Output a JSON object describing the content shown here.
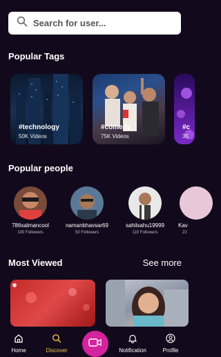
{
  "search": {
    "placeholder": "Search for user..."
  },
  "popular_tags": {
    "title": "Popular Tags",
    "items": [
      {
        "tag": "#technology",
        "count": "50K Videos"
      },
      {
        "tag": "#comedy",
        "count": "75K Videos"
      },
      {
        "tag": "#c",
        "count": "35"
      }
    ]
  },
  "popular_people": {
    "title": "Popular people",
    "items": [
      {
        "username": "786salmancool",
        "followers": "100 Followers"
      },
      {
        "username": "namanbhavsar69",
        "followers": "50 Followers"
      },
      {
        "username": "sahilsahu19999",
        "followers": "110 Followers"
      },
      {
        "username": "Kav",
        "followers": "22"
      }
    ]
  },
  "most_viewed": {
    "title": "Most Viewed",
    "see_more": "See more"
  },
  "nav": {
    "home": "Home",
    "discover": "Discover",
    "notification": "Notification",
    "profile": "Profile",
    "active_color": "#f0c050",
    "record_color": "#d4239e"
  }
}
